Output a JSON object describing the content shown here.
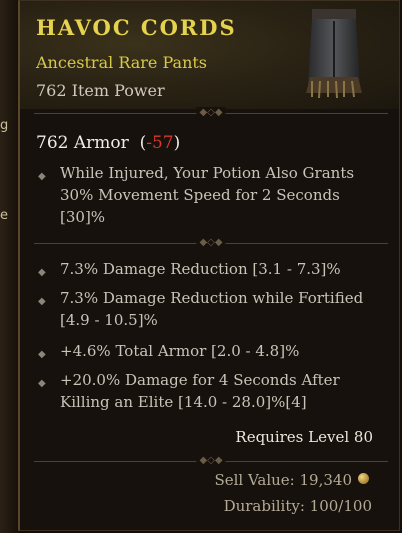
{
  "item": {
    "name": "HAVOC CORDS",
    "subtype": "Ancestral Rare Pants",
    "item_power": "762 Item Power",
    "icon": "pants-icon"
  },
  "armor": {
    "value": "762 Armor",
    "delta_open": "(",
    "delta": "-57",
    "delta_close": ")"
  },
  "implicit_affix": {
    "text": "While Injured, Your Potion Also Grants 30% Movement Speed for 2 Seconds [30]%"
  },
  "affixes": [
    {
      "text": "7.3% Damage Reduction [3.1 - 7.3]%"
    },
    {
      "text": "7.3% Damage Reduction while Fortified [4.9 - 10.5]%"
    },
    {
      "text": "+4.6% Total Armor [2.0 - 4.8]%"
    },
    {
      "text": "+20.0% Damage for 4 Seconds After Killing an Elite [14.0 - 28.0]%[4]"
    }
  ],
  "requirements": "Requires Level 80",
  "sell_value": "Sell Value: 19,340",
  "durability": "Durability: 100/100",
  "background_fragments": [
    "e",
    "g"
  ],
  "colors": {
    "rare_name": "#e5d24e",
    "armor_delta": "#d6382d",
    "affix_text": "#c9c3b8"
  }
}
